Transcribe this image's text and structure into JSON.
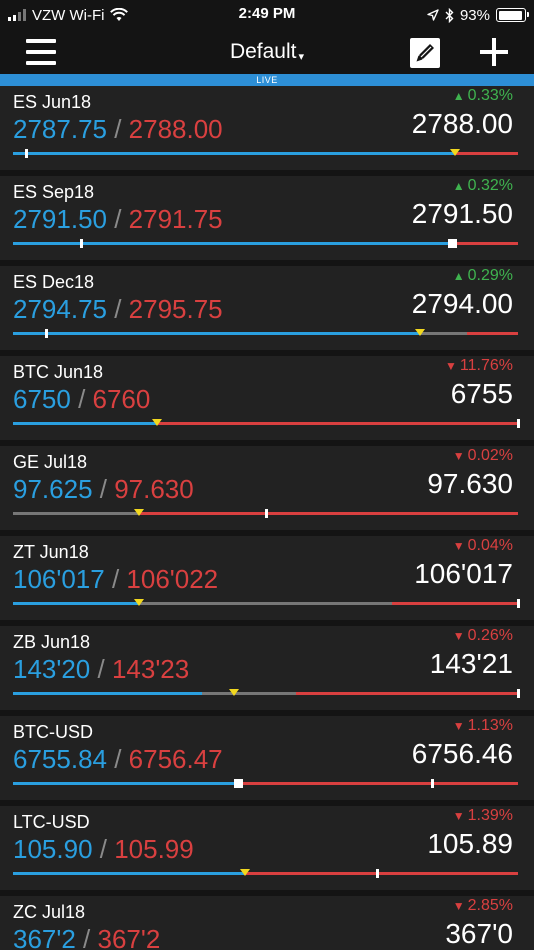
{
  "status_bar": {
    "carrier": "VZW Wi-Fi",
    "time": "2:49 PM",
    "battery": "93%",
    "battery_level": 93
  },
  "nav": {
    "list_name": "Default",
    "caret": "▾"
  },
  "live_label": "LIVE",
  "colors": {
    "bid": "#2a9fe0",
    "ask": "#d94040",
    "up": "#3fb34f",
    "down": "#d94040",
    "marker": "#f2d81f",
    "live": "#2d8fd6"
  },
  "quotes": [
    {
      "symbol": "ES Jun18",
      "bid": "2787.75",
      "ask": "2788.00",
      "direction": "up",
      "change": "0.33%",
      "last": "2788.00",
      "range": {
        "blue_to": 0.875,
        "grey_to": 0.875,
        "tick": 0.025,
        "marker": 0.875
      }
    },
    {
      "symbol": "ES Sep18",
      "bid": "2791.50",
      "ask": "2791.75",
      "direction": "up",
      "change": "0.32%",
      "last": "2791.50",
      "range": {
        "blue_to": 0.87,
        "grey_to": 0.87,
        "tick": 0.135,
        "box": 0.87
      }
    },
    {
      "symbol": "ES Dec18",
      "bid": "2794.75",
      "ask": "2795.75",
      "direction": "up",
      "change": "0.29%",
      "last": "2794.00",
      "range": {
        "blue_to": 0.805,
        "grey_to": 0.9,
        "tick": 0.065,
        "marker": 0.805
      }
    },
    {
      "symbol": "BTC Jun18",
      "bid": "6750",
      "ask": "6760",
      "direction": "down",
      "change": "11.76%",
      "last": "6755",
      "range": {
        "blue_to": 0.285,
        "grey_to": 0.285,
        "tick": 1.0,
        "marker": 0.285
      }
    },
    {
      "symbol": "GE Jul18",
      "bid": "97.625",
      "ask": "97.630",
      "direction": "down",
      "change": "0.02%",
      "last": "97.630",
      "range": {
        "blue_to": 0.0,
        "grey_to": 0.25,
        "tick": 0.5,
        "marker": 0.25
      }
    },
    {
      "symbol": "ZT Jun18",
      "bid": "106'017",
      "ask": "106'022",
      "direction": "down",
      "change": "0.04%",
      "last": "106'017",
      "range": {
        "blue_to": 0.25,
        "grey_to": 0.75,
        "tick": 1.0,
        "marker": 0.25
      }
    },
    {
      "symbol": "ZB Jun18",
      "bid": "143'20",
      "ask": "143'23",
      "direction": "down",
      "change": "0.26%",
      "last": "143'21",
      "range": {
        "blue_to": 0.375,
        "grey_to": 0.56,
        "tick": 1.0,
        "marker": 0.437
      }
    },
    {
      "symbol": "BTC-USD",
      "bid": "6755.84",
      "ask": "6756.47",
      "direction": "down",
      "change": "1.13%",
      "last": "6756.46",
      "range": {
        "blue_to": 0.445,
        "grey_to": 0.445,
        "tick": 0.83,
        "box": 0.445
      }
    },
    {
      "symbol": "LTC-USD",
      "bid": "105.90",
      "ask": "105.99",
      "direction": "down",
      "change": "1.39%",
      "last": "105.89",
      "range": {
        "blue_to": 0.46,
        "grey_to": 0.46,
        "tick": 0.72,
        "marker": 0.46
      }
    },
    {
      "symbol": "ZC Jul18",
      "bid": "367'2",
      "ask": "367'2",
      "direction": "down",
      "change": "2.85%",
      "last": "367'0",
      "range": {
        "blue_to": 0.5,
        "grey_to": 0.5,
        "tick": 0.5,
        "marker": 0.5
      }
    }
  ]
}
